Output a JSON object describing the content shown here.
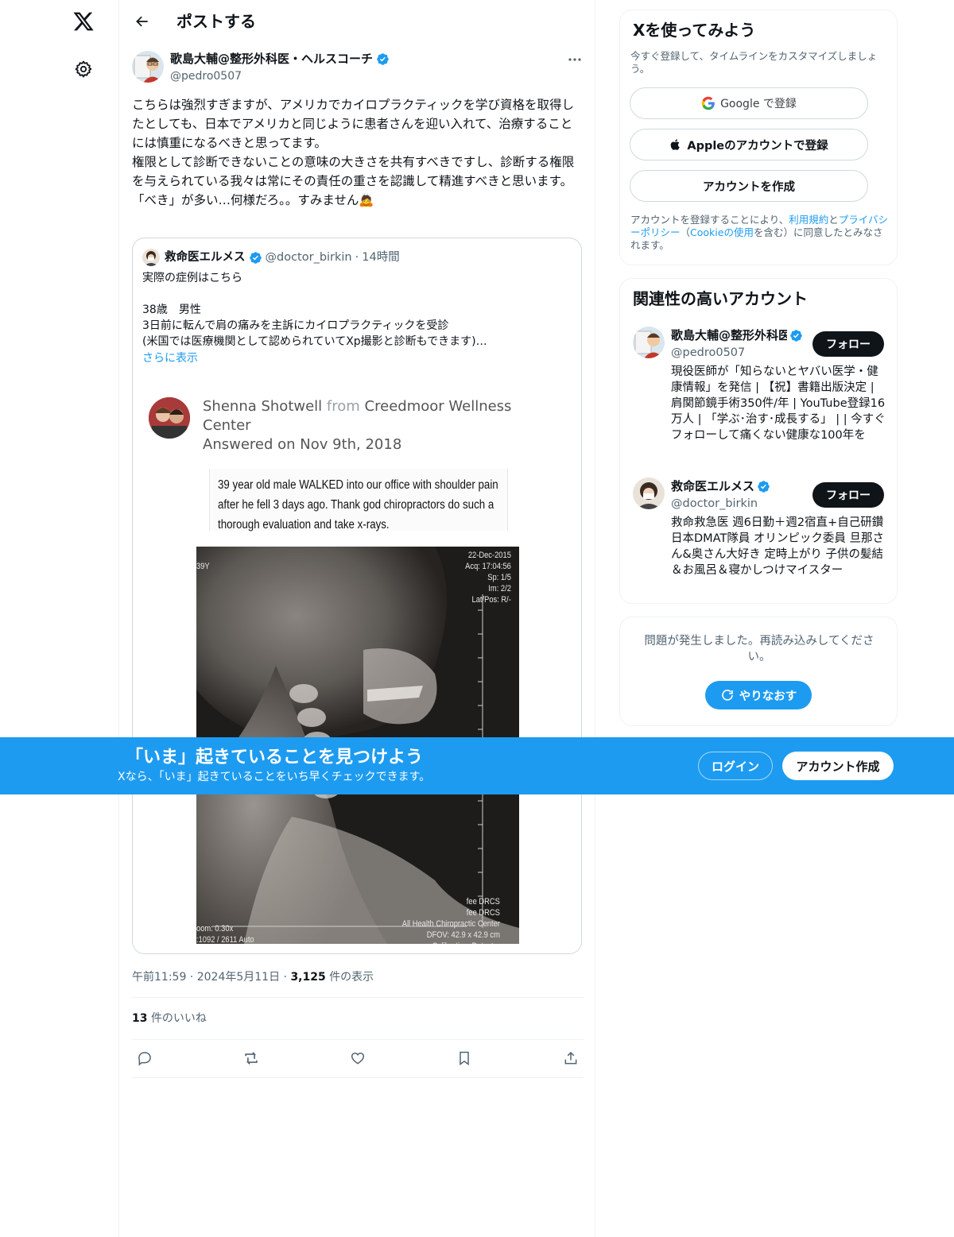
{
  "nav": {
    "logo_icon": "x-logo-icon",
    "settings_icon": "gear-icon"
  },
  "header": {
    "title": "ポストする",
    "back_icon": "arrow-left-icon"
  },
  "post": {
    "author_name": "歌島大輔@整形外科医・ヘルスコーチ",
    "author_handle": "@pedro0507",
    "more_icon": "more-icon",
    "text": "こちらは強烈すぎますが、アメリカでカイロプラクティックを学び資格を取得したとしても、日本でアメリカと同じように患者さんを迎い入れて、治療することには慎重になるべきと思ってます。\n権限として診断できないことの意味の大きさを共有すべきですし、診断する権限を与えられている我々は常にその責任の重さを認識して精進すべきと思います。\n「べき」が多い…何様だろ。。すみません🙇",
    "time": "午前11:59",
    "date": "2024年5月11日",
    "views_count": "3,125",
    "views_label": "件の表示",
    "likes_count": "13",
    "likes_label": "件のいいね",
    "actions": [
      "reply-icon",
      "repost-icon",
      "like-icon",
      "bookmark-icon",
      "share-icon"
    ]
  },
  "quote": {
    "name": "救命医エルメス",
    "handle": "@doctor_birkin",
    "dot": "·",
    "age": "14時間",
    "text": "実際の症例はこちら\n\n38歳　男性\n3日前に転んで肩の痛みを主訴にカイロプラクティックを受診\n(米国では医療機関として認められていてXp撮影と診断もできます)…",
    "show_more": "さらに表示",
    "image": {
      "answerer_name": "Shenna Shotwell",
      "answerer_from": "from",
      "answerer_org": "Creedmoor Wellness Center",
      "answered_date": "Answered on Nov 9th, 2018",
      "note": "39 year old male WALKED into our office with shoulder pain after he fell 3 days ago. Thank god chiropractors do such a thorough evaluation and take x-rays.",
      "xray_top_right": "22-Dec-2015\nAcq: 17:04:56\nSp: 1/5\nIm: 2/2\nLat/Pos: R/-",
      "xray_top_left": "39Y",
      "xray_bottom_right": "fee DRCS\nfee DRCS\nAll Health Chiropractic Center\nDFOV: 42.9 x 42.9 cm\nCalibration: Detector",
      "xray_bottom_left": "oom: 0.30x\n:1092 / 2611 Auto"
    }
  },
  "signup": {
    "title": "Xを使ってみよう",
    "subtitle": "今すぐ登録して、タイムラインをカスタマイズしましょう。",
    "google_label": "Google で登録",
    "apple_label": "Appleのアカウントで登録",
    "create_label": "アカウントを作成",
    "terms_1": "アカウントを登録することにより、",
    "terms_link_1": "利用規約",
    "terms_2": "と",
    "terms_link_2": "プライバシーポリシー",
    "terms_3": "（",
    "terms_link_3": "Cookieの使用",
    "terms_4": "を含む）に同意したとみなされます。"
  },
  "related": {
    "title": "関連性の高いアカウント",
    "accounts": [
      {
        "name": "歌島大輔@整形外科医・ヘルスコーチ",
        "handle": "@pedro0507",
        "bio": "現役医師が「知らないとヤバい医学・健康情報」を発信 | 【祝】書籍出版決定 | 肩関節鏡手術350件/年 | YouTube登録16万人 | 「学ぶ･治す･成長する」 | | 今すぐフォローして痛くない健康な100年を",
        "follow": "フォロー"
      },
      {
        "name": "救命医エルメス",
        "handle": "@doctor_birkin",
        "bio": "救命救急医 週6日勤＋週2宿直+自己研鑽 日本DMAT隊員 オリンピック委員 旦那さん&奥さん大好き 定時上がり 子供の髪結＆お風呂＆寝かしつけマイスター",
        "follow": "フォロー"
      }
    ]
  },
  "error": {
    "message": "問題が発生しました。再読み込みしてください。",
    "retry": "やりなおす"
  },
  "banner": {
    "title": "「いま」起きていることを見つけよう",
    "subtitle": "Xなら、「いま」起きていることをいち早くチェックできます。",
    "login": "ログイン",
    "signup": "アカウント作成"
  },
  "colors": {
    "accent": "#1d9bf0",
    "text": "#0f1419",
    "muted": "#536471",
    "border": "#eff3f4"
  }
}
